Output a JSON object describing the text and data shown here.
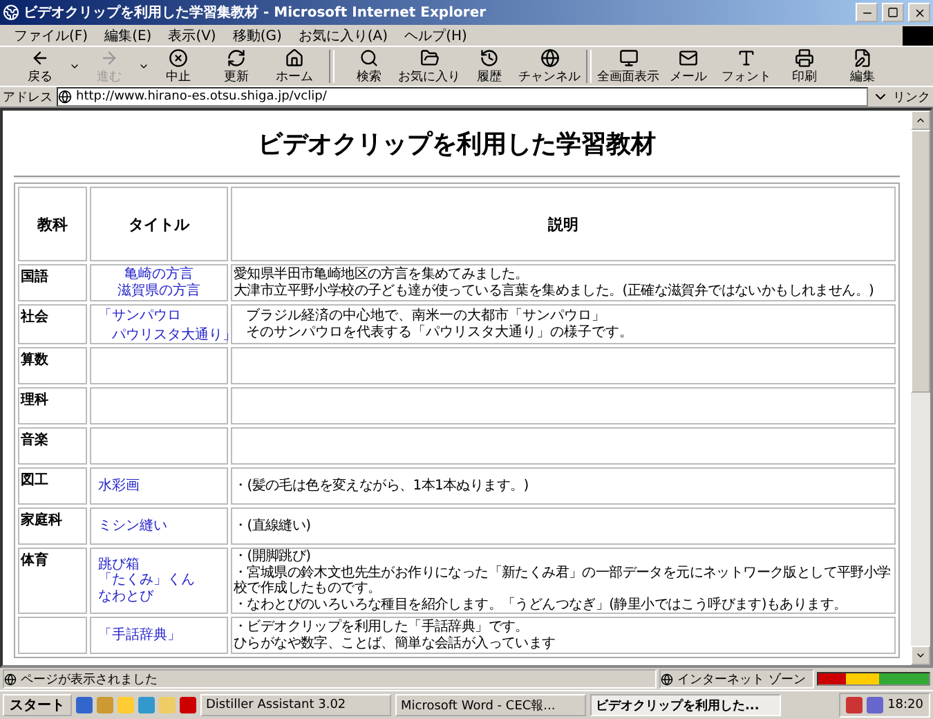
{
  "window": {
    "title": "ビデオクリップを利用した学習集教材 - Microsoft Internet Explorer"
  },
  "menu": [
    "ファイル(F)",
    "編集(E)",
    "表示(V)",
    "移動(G)",
    "お気に入り(A)",
    "ヘルプ(H)"
  ],
  "toolbar": [
    {
      "label": "戻る",
      "disabled": false,
      "dropdown": true
    },
    {
      "label": "進む",
      "disabled": true,
      "dropdown": true
    },
    {
      "label": "中止",
      "disabled": false,
      "dropdown": false
    },
    {
      "label": "更新",
      "disabled": false,
      "dropdown": false
    },
    {
      "label": "ホーム",
      "disabled": false,
      "dropdown": false
    },
    {
      "label": "検索",
      "disabled": false,
      "dropdown": false
    },
    {
      "label": "お気に入り",
      "disabled": false,
      "dropdown": false
    },
    {
      "label": "履歴",
      "disabled": false,
      "dropdown": false
    },
    {
      "label": "チャンネル",
      "disabled": false,
      "dropdown": false
    },
    {
      "label": "全画面表示",
      "disabled": false,
      "dropdown": false
    },
    {
      "label": "メール",
      "disabled": false,
      "dropdown": false
    },
    {
      "label": "フォント",
      "disabled": false,
      "dropdown": false
    },
    {
      "label": "印刷",
      "disabled": false,
      "dropdown": false
    },
    {
      "label": "編集",
      "disabled": false,
      "dropdown": false
    }
  ],
  "address": {
    "label": "アドレス",
    "value": "http://www.hirano-es.otsu.shiga.jp/vclip/",
    "links": "リンク"
  },
  "page": {
    "heading": "ビデオクリップを利用した学習教材",
    "columns": [
      "教科",
      "タイトル",
      "説明"
    ],
    "rows": [
      {
        "subject": "国語",
        "titles": [
          "亀崎の方言",
          "滋賀県の方言"
        ],
        "kind": "normal",
        "center": true,
        "description": [
          "愛知県半田市亀崎地区の方言を集めてみました。",
          "大津市立平野小学校の子ども達が使っている言葉を集めました。(正確な滋賀弁ではないかもしれません。)"
        ]
      },
      {
        "subject": "社会",
        "titles": [
          "「サンパウロ",
          "　パウリスタ大通り」"
        ],
        "kind": "small",
        "center": false,
        "description": [
          "ブラジル経済の中心地で、南米一の大都市「サンパウロ」",
          "そのサンパウロを代表する「パウリスタ大通り」の様子です。"
        ]
      },
      {
        "subject": "算数",
        "titles": [],
        "kind": "normal",
        "description": []
      },
      {
        "subject": "理科",
        "titles": [],
        "kind": "normal",
        "description": []
      },
      {
        "subject": "音楽",
        "titles": [],
        "kind": "normal",
        "description": []
      },
      {
        "subject": "図工",
        "titles": [
          "水彩画"
        ],
        "kind": "normal",
        "center": false,
        "description": [
          "・(髪の毛は色を変えながら、1本1本ぬります。)"
        ]
      },
      {
        "subject": "家庭科",
        "titles": [
          "ミシン縫い"
        ],
        "kind": "normal",
        "center": false,
        "description": [
          "・(直線縫い)"
        ]
      },
      {
        "subject": "体育",
        "titles": [
          "跳び箱",
          "「たくみ」くん",
          "なわとび"
        ],
        "kind": "normal",
        "center": false,
        "description": [
          "・(開脚跳び)",
          "・宮城県の鈴木文也先生がお作りになった「新たくみ君」の一部データを元にネットワーク版として平野小学校で作成したものです。",
          "・なわとびのいろいろな種目を紹介します。「うどんつなぎ」(静里小ではこう呼びます)もあります。"
        ]
      },
      {
        "subject": "",
        "titles": [
          "「手話辞典」"
        ],
        "kind": "normal",
        "center": false,
        "description": [
          "・ビデオクリップを利用した「手話辞典」です。",
          "ひらがなや数字、ことば、簡単な会話が入っています"
        ]
      }
    ]
  },
  "status_bar": {
    "message": "ページが表示されました",
    "zone": "インターネット ゾーン"
  },
  "taskbar": {
    "start": "スタート",
    "tasks": [
      {
        "label": "Distiller Assistant 3.02",
        "selected": false
      },
      {
        "label": "Microsoft Word - CEC報...",
        "selected": false
      },
      {
        "label": "ビデオクリップを利用した...",
        "selected": true
      }
    ],
    "time": "18:20"
  }
}
